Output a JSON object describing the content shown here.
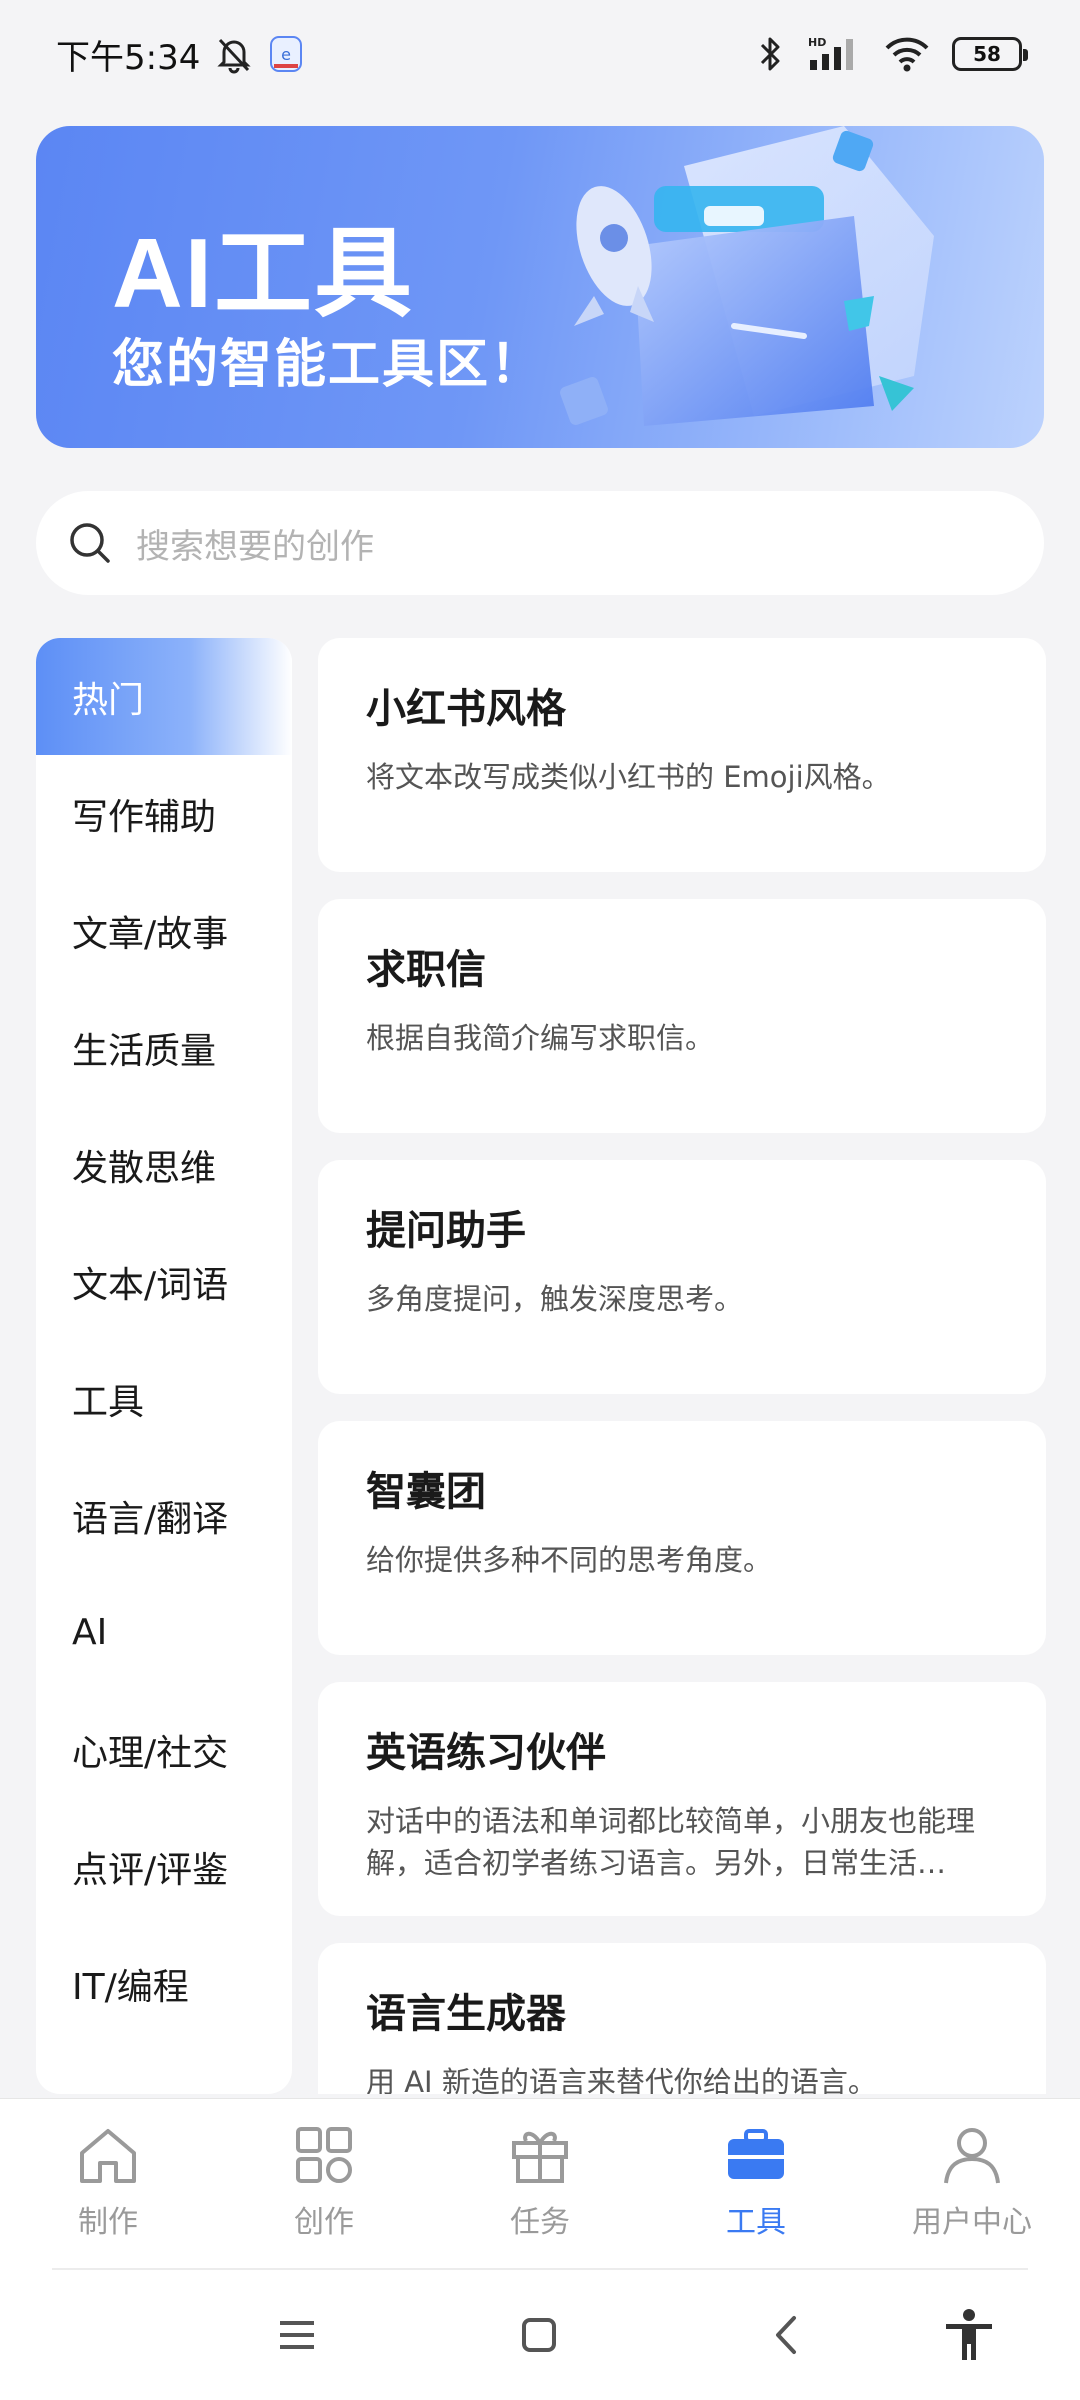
{
  "status_bar": {
    "time": "下午5:34",
    "battery": "58",
    "network_label": "HD"
  },
  "banner": {
    "title": "AI工具",
    "subtitle": "您的智能工具区！"
  },
  "search": {
    "placeholder": "搜索想要的创作"
  },
  "categories": [
    {
      "label": "热门",
      "active": true
    },
    {
      "label": "写作辅助"
    },
    {
      "label": "文章/故事"
    },
    {
      "label": "生活质量"
    },
    {
      "label": "发散思维"
    },
    {
      "label": "文本/词语"
    },
    {
      "label": "工具"
    },
    {
      "label": "语言/翻译"
    },
    {
      "label": "AI"
    },
    {
      "label": "心理/社交"
    },
    {
      "label": "点评/评鉴"
    },
    {
      "label": "IT/编程"
    }
  ],
  "cards": [
    {
      "title": "小红书风格",
      "desc": "将文本改写成类似小红书的 Emoji风格。"
    },
    {
      "title": "求职信",
      "desc": "根据自我简介编写求职信。"
    },
    {
      "title": "提问助手",
      "desc": "多角度提问，触发深度思考。"
    },
    {
      "title": "智囊团",
      "desc": "给你提供多种不同的思考角度。"
    },
    {
      "title": "英语练习伙伴",
      "desc": "对话中的语法和单词都比较简单，小朋友也能理解，适合初学者练习语言。另外，日常生活…"
    },
    {
      "title": "语言生成器",
      "desc": "用 AI 新造的语言来替代你给出的语言。"
    }
  ],
  "bottom_nav": [
    {
      "label": "制作",
      "icon": "home-icon"
    },
    {
      "label": "创作",
      "icon": "grid-icon"
    },
    {
      "label": "任务",
      "icon": "gift-icon"
    },
    {
      "label": "工具",
      "icon": "briefcase-icon",
      "active": true
    },
    {
      "label": "用户中心",
      "icon": "user-icon"
    }
  ],
  "colors": {
    "accent": "#3a7af2",
    "banner_start": "#5b86f3",
    "banner_end": "#bcd2fd",
    "background": "#f4f4f6"
  }
}
